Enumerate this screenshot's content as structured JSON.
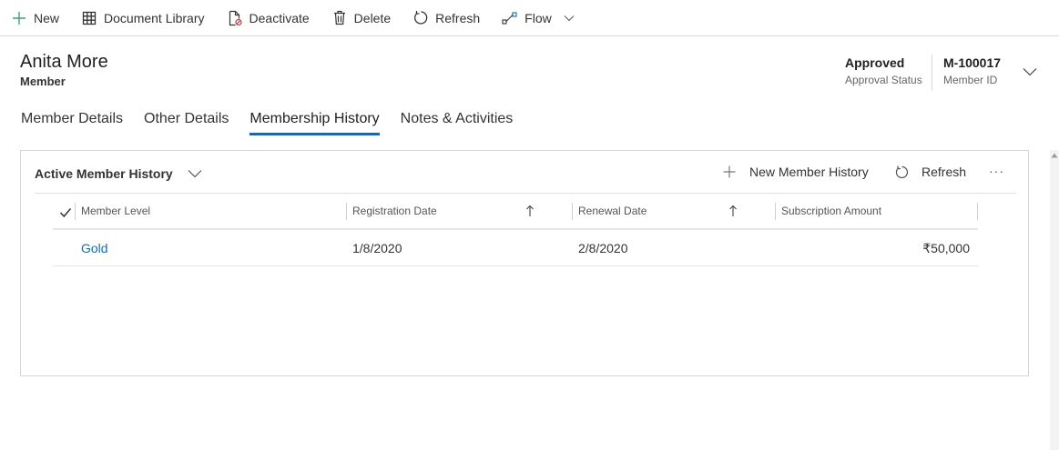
{
  "command_bar": {
    "items": [
      {
        "label": "New",
        "icon": "plus-icon"
      },
      {
        "label": "Document Library",
        "icon": "grid-icon"
      },
      {
        "label": "Deactivate",
        "icon": "deactivate-icon"
      },
      {
        "label": "Delete",
        "icon": "trash-icon"
      },
      {
        "label": "Refresh",
        "icon": "refresh-icon"
      },
      {
        "label": "Flow",
        "icon": "flow-icon"
      }
    ]
  },
  "header": {
    "title": "Anita More",
    "entity": "Member",
    "fields": [
      {
        "value": "Approved",
        "label": "Approval Status"
      },
      {
        "value": "M-100017",
        "label": "Member ID"
      }
    ]
  },
  "tabs": [
    {
      "label": "Member Details"
    },
    {
      "label": "Other Details"
    },
    {
      "label": "Membership History",
      "active": true
    },
    {
      "label": "Notes & Activities"
    }
  ],
  "subgrid": {
    "view_name": "Active Member History",
    "commands": {
      "new_label": "New Member History",
      "refresh_label": "Refresh"
    },
    "columns": [
      {
        "label": "Member Level"
      },
      {
        "label": "Registration Date",
        "sorted": "ascending"
      },
      {
        "label": "Renewal Date",
        "sorted": "ascending"
      },
      {
        "label": "Subscription Amount"
      }
    ],
    "rows": [
      {
        "member_level": "Gold",
        "registration_date": "1/8/2020",
        "renewal_date": "2/8/2020",
        "subscription_amount": "₹50,000"
      }
    ]
  },
  "colors": {
    "accent": "#0f6cbd",
    "new_icon": "#3aa66e",
    "text": "#333333"
  }
}
